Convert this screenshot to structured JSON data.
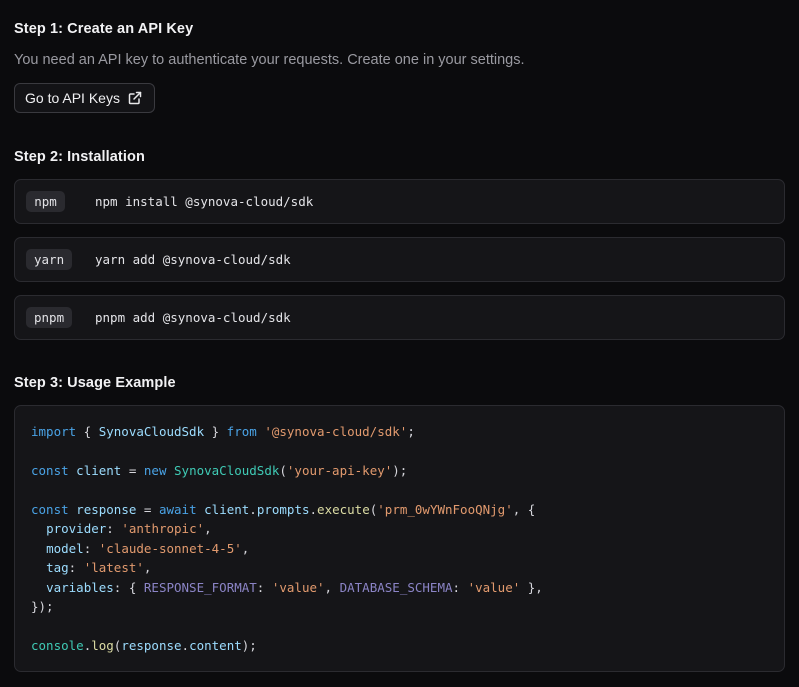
{
  "step1": {
    "title": "Step 1: Create an API Key",
    "description": "You need an API key to authenticate your requests. Create one in your settings.",
    "button_label": "Go to API Keys",
    "button_icon": "external-link-icon"
  },
  "step2": {
    "title": "Step 2: Installation",
    "managers": [
      {
        "name": "npm",
        "command": "npm install @synova-cloud/sdk"
      },
      {
        "name": "yarn",
        "command": "yarn add @synova-cloud/sdk"
      },
      {
        "name": "pnpm",
        "command": "pnpm add @synova-cloud/sdk"
      }
    ]
  },
  "step3": {
    "title": "Step 3: Usage Example",
    "code": {
      "l1": {
        "import": "import",
        "open": " { ",
        "cls": "SynovaCloudSdk",
        "close": " } ",
        "from": "from",
        "sp": " ",
        "mod": "'@synova-cloud/sdk'",
        "end": ";"
      },
      "l2": {
        "const": "const",
        "sp1": " ",
        "var": "client",
        "eq": " = ",
        "new": "new",
        "sp2": " ",
        "cls": "SynovaCloudSdk",
        "open": "(",
        "arg": "'your-api-key'",
        "end": ");"
      },
      "l3": {
        "const": "const",
        "sp1": " ",
        "var": "response",
        "eq": " = ",
        "await": "await",
        "sp2": " ",
        "obj": "client",
        "dot1": ".",
        "prop": "prompts",
        "dot2": ".",
        "fn": "execute",
        "open": "(",
        "arg": "'prm_0wYWnFooQNjg'",
        "end": ", {"
      },
      "l4": {
        "indent": "  ",
        "key": "provider",
        "colon": ": ",
        "val": "'anthropic'",
        "end": ","
      },
      "l5": {
        "indent": "  ",
        "key": "model",
        "colon": ": ",
        "val": "'claude-sonnet-4-5'",
        "end": ","
      },
      "l6": {
        "indent": "  ",
        "key": "tag",
        "colon": ": ",
        "val": "'latest'",
        "end": ","
      },
      "l7": {
        "indent": "  ",
        "key": "variables",
        "colon": ": { ",
        "k1": "RESPONSE_FORMAT",
        "c1": ": ",
        "v1": "'value'",
        "sep": ", ",
        "k2": "DATABASE_SCHEMA",
        "c2": ": ",
        "v2": "'value'",
        "end": " },"
      },
      "l8": {
        "text": "});"
      },
      "l9": {
        "obj": "console",
        "dot1": ".",
        "fn": "log",
        "open": "(",
        "arg": "response",
        "dot2": ".",
        "prop": "content",
        "end": ");"
      }
    }
  },
  "colors": {
    "background": "#0b0b0d",
    "panel": "#151518",
    "keyword": "#4aa3e6",
    "class": "#3fcab5",
    "string": "#e29a6e"
  }
}
